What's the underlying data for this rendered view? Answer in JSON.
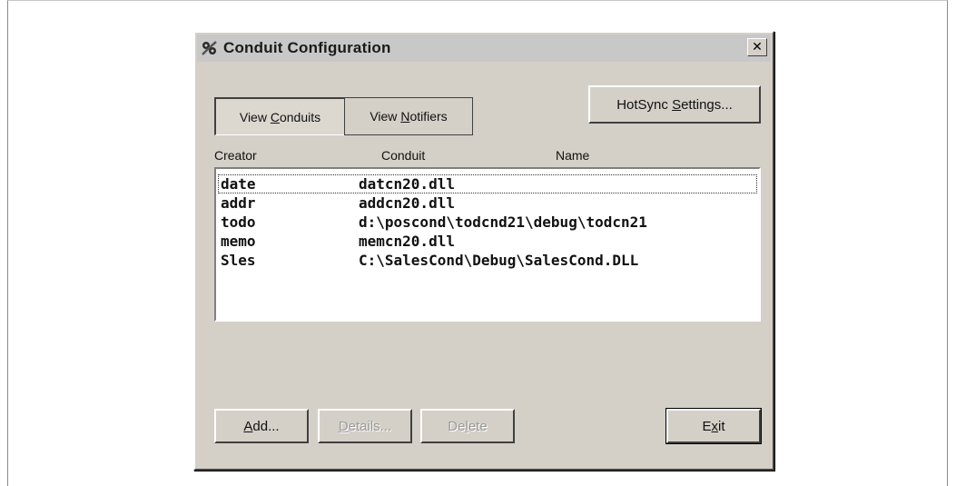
{
  "window": {
    "title": "Conduit Configuration",
    "close_label": "✕"
  },
  "tabs": [
    {
      "label_pre": "View ",
      "label_key": "C",
      "label_post": "onduits",
      "active": true
    },
    {
      "label_pre": "View ",
      "label_key": "N",
      "label_post": "otifiers",
      "active": false
    }
  ],
  "hotsync_button": {
    "label_pre": "HotSync ",
    "label_key": "S",
    "label_post": "ettings..."
  },
  "columns": {
    "creator": "Creator",
    "conduit": "Conduit",
    "name": "Name"
  },
  "conduits": [
    {
      "creator": "date",
      "conduit": "datcn20.dll"
    },
    {
      "creator": "addr",
      "conduit": "addcn20.dll"
    },
    {
      "creator": "todo",
      "conduit": "d:\\poscond\\todcnd21\\debug\\todcn21"
    },
    {
      "creator": "memo",
      "conduit": "memcn20.dll"
    },
    {
      "creator": "Sles",
      "conduit": "C:\\SalesCond\\Debug\\SalesCond.DLL"
    }
  ],
  "buttons": {
    "add": {
      "label_key": "A",
      "label_post": "dd...",
      "disabled": false
    },
    "details": {
      "label_key": "D",
      "label_post": "etails...",
      "disabled": true
    },
    "delete": {
      "label_pre": "De",
      "label_key": "l",
      "label_post": "ete",
      "disabled": true
    },
    "exit": {
      "label_pre": "E",
      "label_key": "x",
      "label_post": "it",
      "disabled": false
    }
  }
}
